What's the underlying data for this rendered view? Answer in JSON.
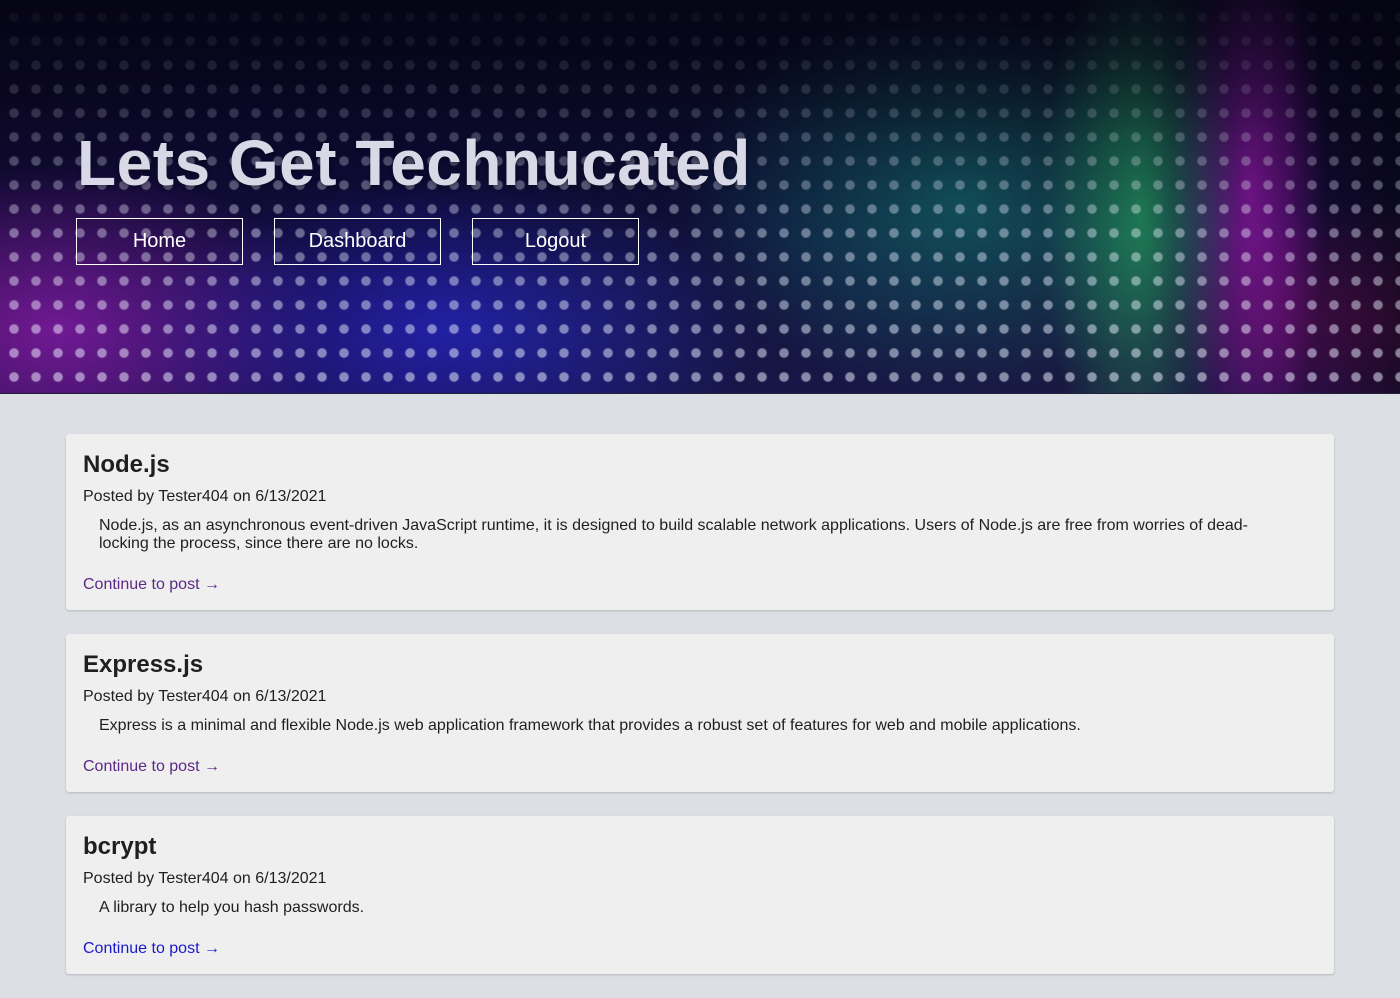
{
  "header": {
    "title": "Lets Get Technucated",
    "nav": [
      {
        "label": "Home"
      },
      {
        "label": "Dashboard"
      },
      {
        "label": "Logout"
      }
    ]
  },
  "posts": [
    {
      "title": "Node.js",
      "meta": "Posted by Tester404 on 6/13/2021",
      "body": "Node.js, as an asynchronous event-driven JavaScript runtime, it is designed to build scalable network applications. Users of Node.js are free from worries of dead-locking the process, since there are no locks.",
      "link": "Continue to post →"
    },
    {
      "title": "Express.js",
      "meta": "Posted by Tester404 on 6/13/2021",
      "body": "Express is a minimal and flexible Node.js web application framework that provides a robust set of features for web and mobile applications.",
      "link": "Continue to post →"
    },
    {
      "title": "bcrypt",
      "meta": "Posted by Tester404 on 6/13/2021",
      "body": "A library to help you hash passwords.",
      "link": "Continue to post →"
    }
  ],
  "colors": {
    "page_background": "#dcdfe4",
    "card_background": "#efefef",
    "visited_link": "#5a2a86",
    "link": "#1a1acb"
  }
}
